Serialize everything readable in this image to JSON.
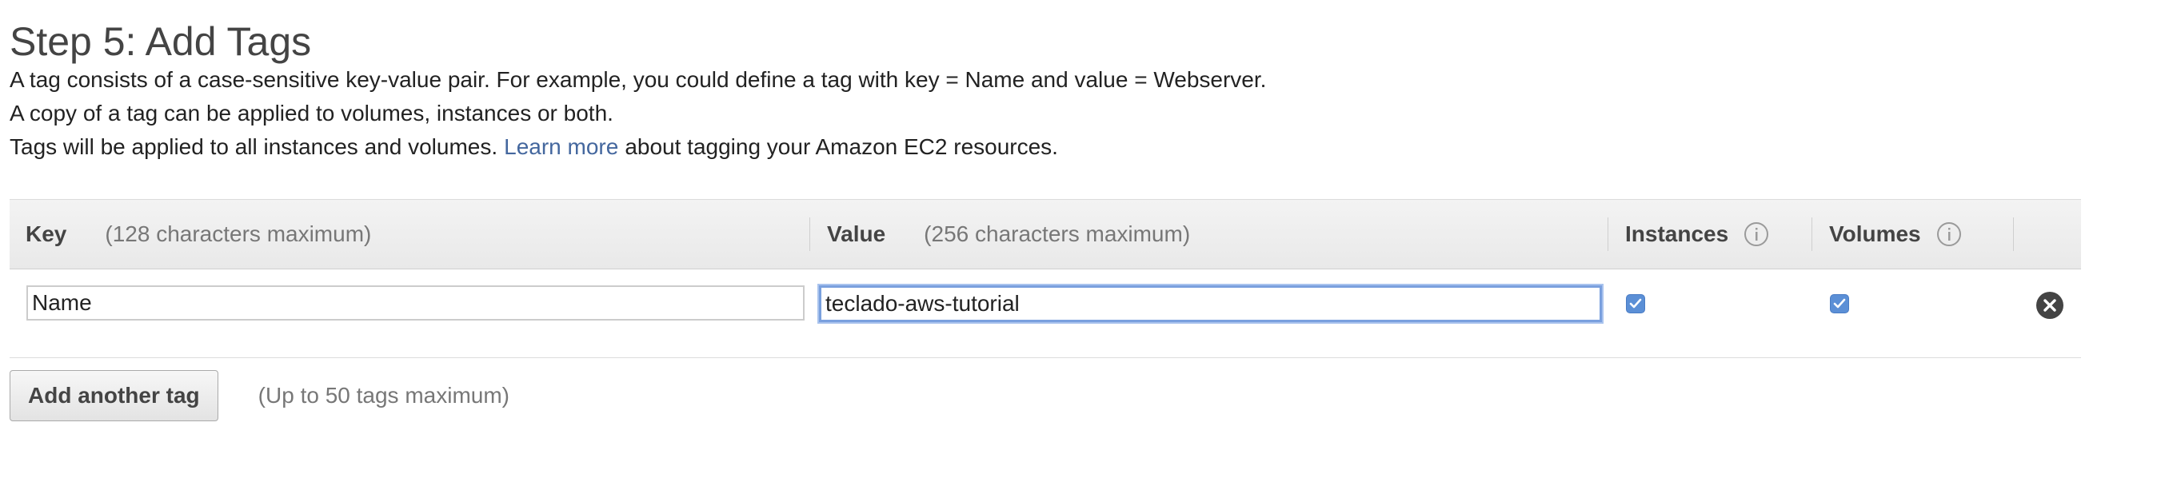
{
  "header": {
    "title": "Step 5: Add Tags",
    "line1": "A tag consists of a case-sensitive key-value pair. For example, you could define a tag with key = Name and value = Webserver.",
    "line2": "A copy of a tag can be applied to volumes, instances or both.",
    "line3_before": "Tags will be applied to all instances and volumes.",
    "learn_more": "Learn more",
    "line3_after": "about tagging your Amazon EC2 resources."
  },
  "table": {
    "columns": {
      "key_label": "Key",
      "key_hint": "(128 characters maximum)",
      "value_label": "Value",
      "value_hint": "(256 characters maximum)",
      "instances_label": "Instances",
      "volumes_label": "Volumes"
    },
    "rows": [
      {
        "key": "Name",
        "value": "teclado-aws-tutorial",
        "instances_checked": true,
        "volumes_checked": true
      }
    ]
  },
  "footer": {
    "add_button": "Add another tag",
    "limit_note": "(Up to 50 tags maximum)"
  },
  "icons": {
    "info": "info-icon",
    "checkbox": "checkmark-icon",
    "remove": "remove-circle-icon"
  },
  "colors": {
    "link": "#44679e",
    "checkbox": "#5b8fd6",
    "focus_ring": "#7aa0de"
  }
}
